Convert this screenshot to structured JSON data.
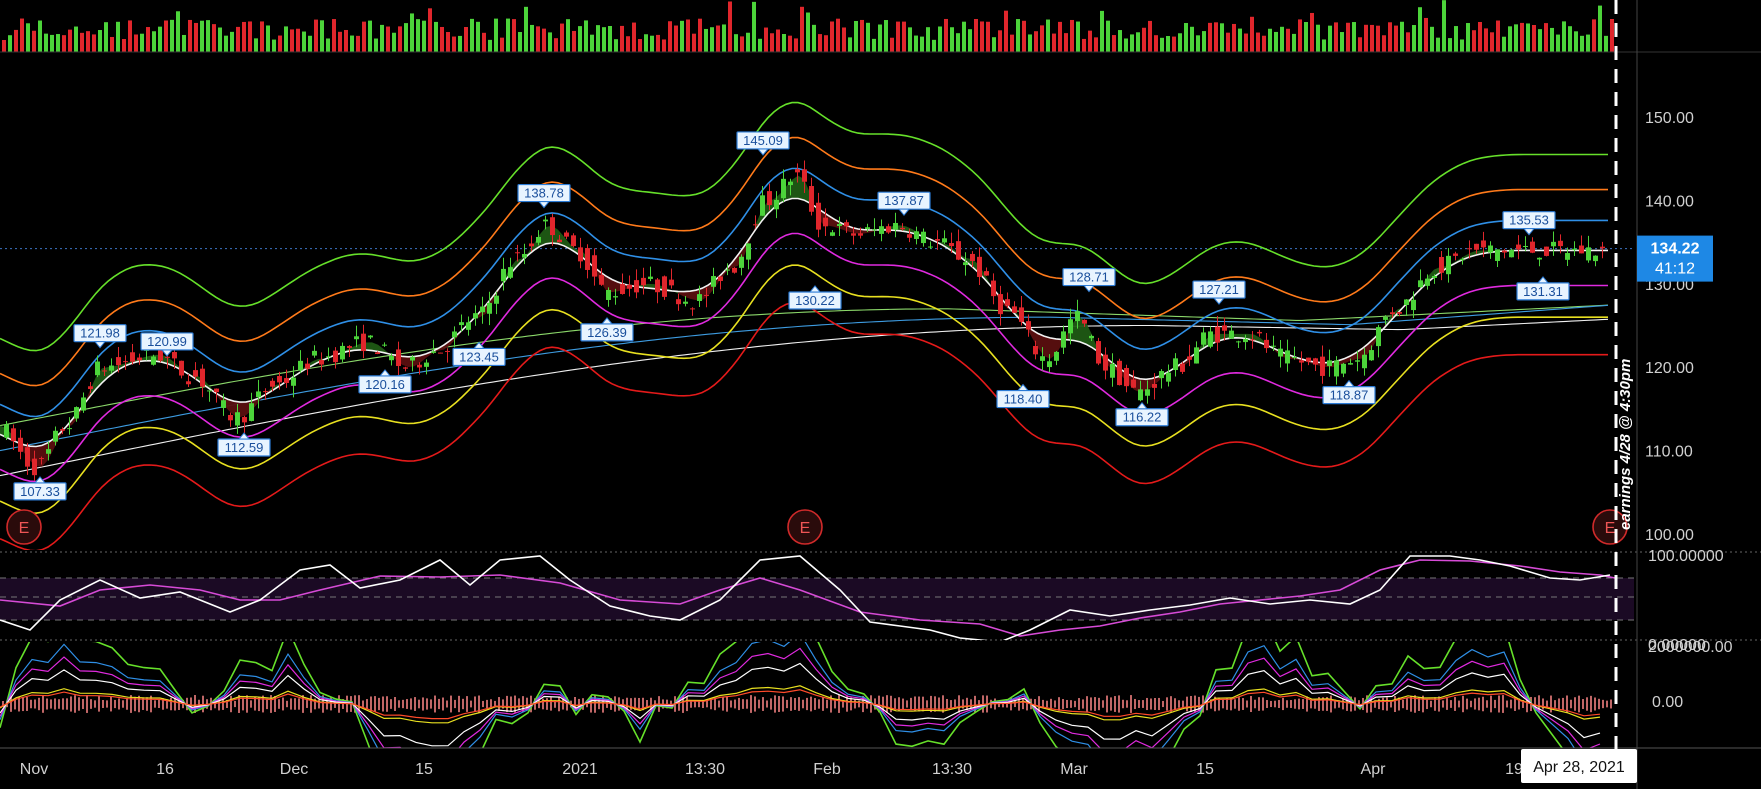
{
  "chart_data": {
    "type": "candlestick",
    "price_axis": {
      "ticks": [
        "150.00",
        "140.00",
        "130.00",
        "120.00",
        "110.00",
        "100.00"
      ],
      "min": 97,
      "max": 160
    },
    "x_ticks": [
      "Nov",
      "16",
      "Dec",
      "15",
      "2021",
      "13:30",
      "Feb",
      "13:30",
      "Mar",
      "15",
      "Apr",
      "19"
    ],
    "current_price": "134.22",
    "countdown": "41:12",
    "date_label": "Apr 28, 2021",
    "earnings_label": "earnings 4/28 @ 4:30pm",
    "earnings_marker": "E",
    "highlights": [
      {
        "label": "107.33",
        "value": 107.33,
        "pos": "below"
      },
      {
        "label": "121.98",
        "value": 121.98,
        "pos": "above"
      },
      {
        "label": "120.99",
        "value": 120.99,
        "pos": "above"
      },
      {
        "label": "112.59",
        "value": 112.59,
        "pos": "below"
      },
      {
        "label": "120.16",
        "value": 120.16,
        "pos": "below"
      },
      {
        "label": "123.45",
        "value": 123.45,
        "pos": "below"
      },
      {
        "label": "138.78",
        "value": 138.78,
        "pos": "above"
      },
      {
        "label": "126.39",
        "value": 126.39,
        "pos": "below"
      },
      {
        "label": "145.09",
        "value": 145.09,
        "pos": "above"
      },
      {
        "label": "130.22",
        "value": 130.22,
        "pos": "below"
      },
      {
        "label": "137.87",
        "value": 137.87,
        "pos": "above"
      },
      {
        "label": "118.40",
        "value": 118.4,
        "pos": "below"
      },
      {
        "label": "128.71",
        "value": 128.71,
        "pos": "above"
      },
      {
        "label": "116.22",
        "value": 116.22,
        "pos": "below"
      },
      {
        "label": "127.21",
        "value": 127.21,
        "pos": "above"
      },
      {
        "label": "118.87",
        "value": 118.87,
        "pos": "below"
      },
      {
        "label": "135.53",
        "value": 135.53,
        "pos": "above"
      },
      {
        "label": "131.31",
        "value": 131.31,
        "pos": "below"
      }
    ],
    "oscillator_axis": {
      "ticks": [
        "100.00000",
        "0.00000"
      ]
    },
    "histogram_axis": {
      "ticks": [
        "2000000.00",
        "0.00"
      ]
    },
    "colors": {
      "up": "#4cd43a",
      "down": "#e0262c",
      "band_outer": "#66e02a",
      "band_orange": "#ff7a1a",
      "band_blue": "#2f8fe6",
      "band_magenta": "#e02adf",
      "band_yellow": "#e8e020",
      "band_red": "#e41a1a",
      "mid": "#f2f2f2",
      "osc_white": "#ffffff",
      "osc_magenta": "#d64bd6",
      "price_badge": "#1e88e5"
    }
  }
}
